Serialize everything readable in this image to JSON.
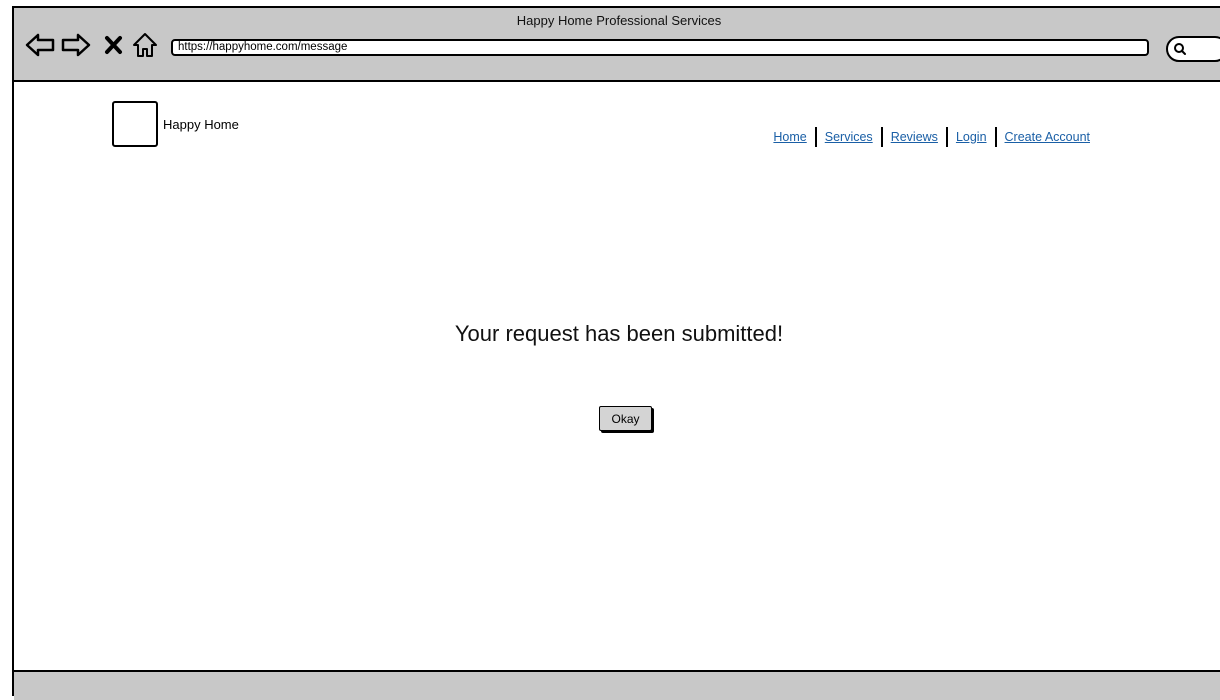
{
  "window": {
    "title": "Happy Home Professional Services"
  },
  "browser": {
    "url": "https://happyhome.com/message",
    "icons": [
      "back-arrow-icon",
      "forward-arrow-icon",
      "close-x-icon",
      "home-icon",
      "search-icon"
    ]
  },
  "header": {
    "brand": "Happy Home",
    "nav": {
      "home": "Home",
      "services": "Services",
      "reviews": "Reviews",
      "login": "Login",
      "create_account": "Create Account"
    }
  },
  "main": {
    "message": "Your request has been submitted!",
    "okay_label": "Okay"
  },
  "colors": {
    "chrome_gray": "#c8c8c8",
    "link_blue": "#1a5fa6",
    "button_gray": "#d4d4d4"
  }
}
